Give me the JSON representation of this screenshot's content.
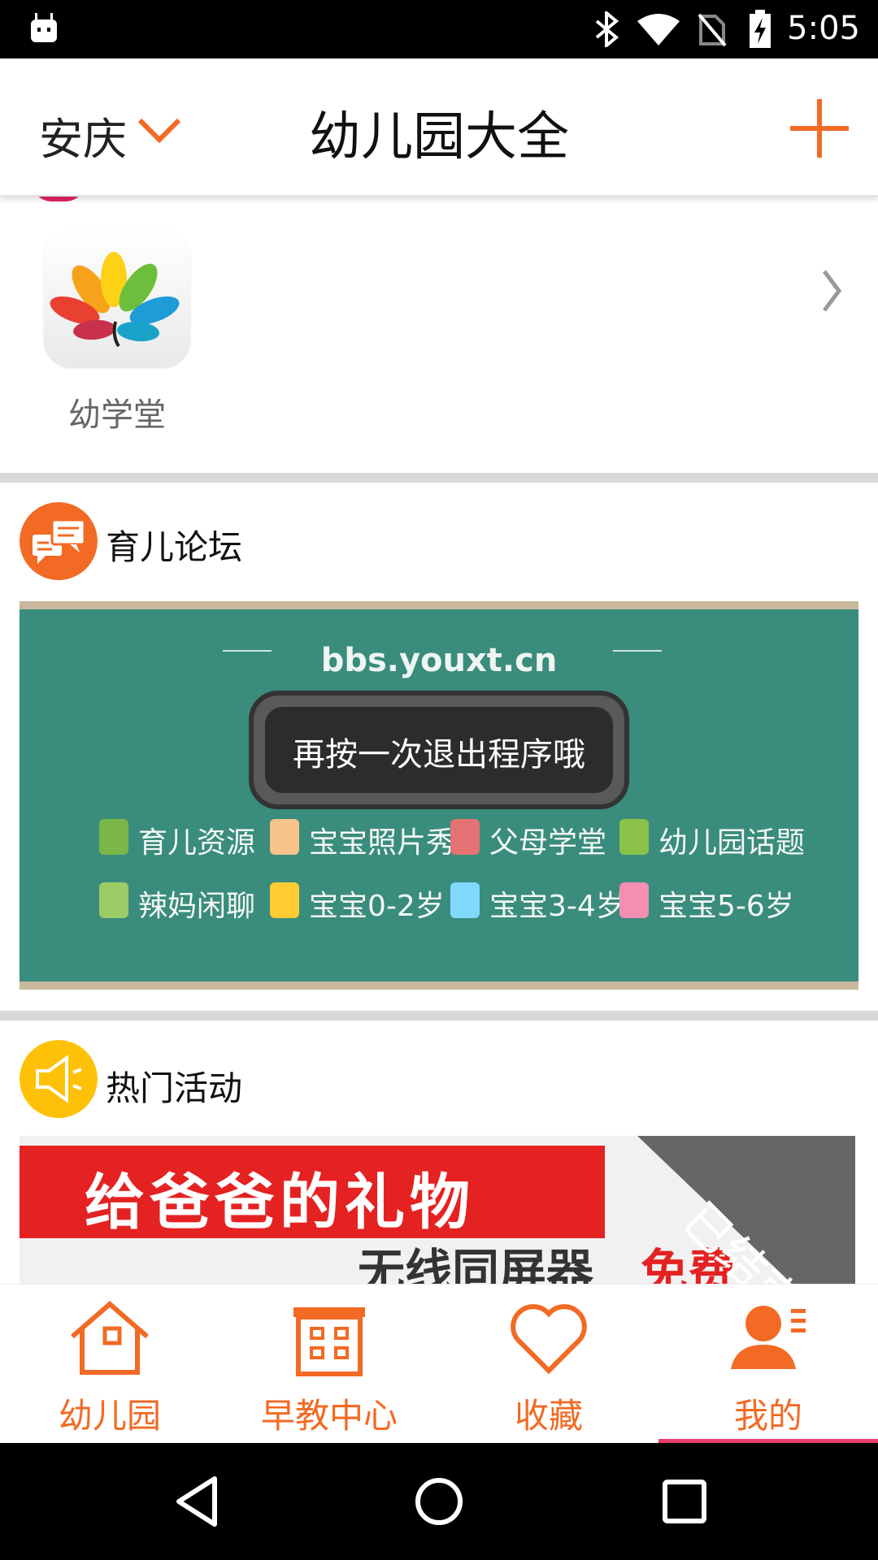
{
  "status_bar": {
    "time": "5:05",
    "icons": [
      "android-debug-icon",
      "bluetooth-icon",
      "wifi-icon",
      "no-sim-icon",
      "battery-charging-icon"
    ]
  },
  "header": {
    "city": "安庆",
    "title": "幼儿园大全",
    "accent_color": "#f26a24"
  },
  "apps_section": {
    "items": [
      {
        "label": "幼学堂",
        "icon": "peacock-logo-icon"
      }
    ]
  },
  "forum_section": {
    "title": "育儿论坛",
    "icon": "chat-bubbles-icon",
    "banner": {
      "url_text": "bbs.youxt.cn",
      "categories": [
        {
          "label": "育儿资源",
          "icon": "book-icon"
        },
        {
          "label": "宝宝照片秀",
          "icon": "baby-photo-icon"
        },
        {
          "label": "父母学堂",
          "icon": "parents-icon"
        },
        {
          "label": "幼儿园话题",
          "icon": "kindergarten-icon"
        },
        {
          "label": "辣妈闲聊",
          "icon": "chat-icon"
        },
        {
          "label": "宝宝0-2岁",
          "icon": "baby-face-icon"
        },
        {
          "label": "宝宝3-4岁",
          "icon": "baby-face-icon"
        },
        {
          "label": "宝宝5-6岁",
          "icon": "baby-face-icon"
        }
      ]
    }
  },
  "activity_section": {
    "title": "热门活动",
    "icon": "megaphone-icon",
    "banner": {
      "title": "给爸爸的礼物",
      "subtitle": "无线同屏器",
      "free_text": "免费",
      "status_ribbon": "已结束"
    }
  },
  "toast": {
    "message": "再按一次退出程序哦"
  },
  "tab_bar": {
    "tabs": [
      {
        "label": "幼儿园",
        "icon": "house-icon"
      },
      {
        "label": "早教中心",
        "icon": "building-icon"
      },
      {
        "label": "收藏",
        "icon": "heart-icon"
      },
      {
        "label": "我的",
        "icon": "user-icon"
      }
    ],
    "selected": "我的"
  },
  "nav_bar": {
    "buttons": [
      "back-icon",
      "home-icon",
      "recents-icon"
    ]
  }
}
